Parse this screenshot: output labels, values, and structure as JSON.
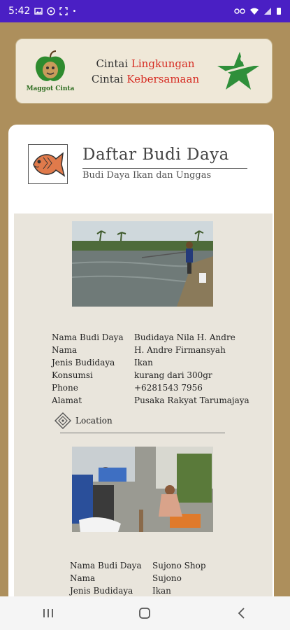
{
  "status": {
    "time": "5:42"
  },
  "banner": {
    "logo_text": "Maggot Cinta",
    "line1_prefix": "Cintai ",
    "line1_accent": "Lingkungan",
    "line2_prefix": "Cintai ",
    "line2_accent": "Kebersamaan",
    "accent_color": "#d62b22"
  },
  "header": {
    "title": "Daftar Budi Daya",
    "subtitle": "Budi Daya Ikan dan Unggas"
  },
  "items": [
    {
      "labels": [
        "Nama Budi Daya",
        "Nama",
        "Jenis Budidaya",
        "Konsumsi",
        "Phone",
        "Alamat"
      ],
      "values": [
        "Budidaya Nila H. Andre",
        "H. Andre Firmansyah",
        "Ikan",
        "kurang dari 300gr",
        "+6281543 7956",
        "Pusaka Rakyat Tarumajaya"
      ],
      "location_label": "Location"
    },
    {
      "labels": [
        "Nama Budi Daya",
        "Nama",
        "Jenis Budidaya"
      ],
      "values": [
        "Sujono Shop",
        "Sujono",
        "Ikan"
      ]
    }
  ]
}
